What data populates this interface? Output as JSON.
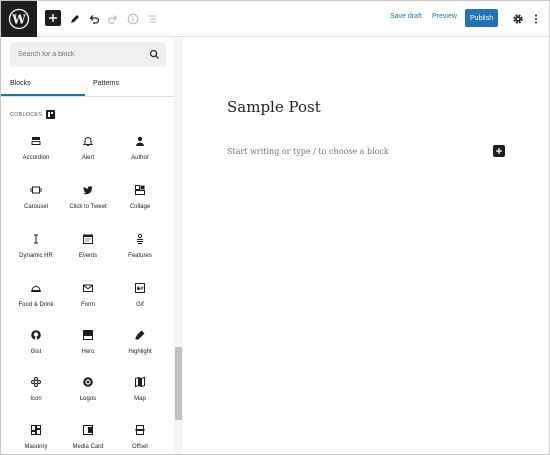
{
  "toolbar": {
    "save_draft": "Save draft",
    "preview": "Preview",
    "publish": "Publish",
    "accent": "#2271b1"
  },
  "sidebar": {
    "search_placeholder": "Search for a block",
    "tabs": [
      {
        "label": "Blocks",
        "active": true
      },
      {
        "label": "Patterns",
        "active": false
      }
    ],
    "category": "COBLOCKS",
    "blocks": [
      {
        "label": "Accordion",
        "icon": "accordion-icon"
      },
      {
        "label": "Alert",
        "icon": "bell-icon"
      },
      {
        "label": "Author",
        "icon": "person-icon"
      },
      {
        "label": "Carousel",
        "icon": "carousel-icon"
      },
      {
        "label": "Click to Tweet",
        "icon": "twitter-icon"
      },
      {
        "label": "Collage",
        "icon": "collage-icon"
      },
      {
        "label": "Dynamic HR",
        "icon": "dynamic-hr-icon"
      },
      {
        "label": "Events",
        "icon": "calendar-icon"
      },
      {
        "label": "Features",
        "icon": "features-icon"
      },
      {
        "label": "Food & Drink",
        "icon": "cloche-icon"
      },
      {
        "label": "Form",
        "icon": "envelope-icon"
      },
      {
        "label": "Gif",
        "icon": "gif-icon"
      },
      {
        "label": "Gist",
        "icon": "github-icon"
      },
      {
        "label": "Hero",
        "icon": "hero-icon"
      },
      {
        "label": "Highlight",
        "icon": "highlighter-icon"
      },
      {
        "label": "Icon",
        "icon": "icon-block-icon"
      },
      {
        "label": "Logos",
        "icon": "logos-icon"
      },
      {
        "label": "Map",
        "icon": "map-icon"
      },
      {
        "label": "Masonry",
        "icon": "masonry-icon"
      },
      {
        "label": "Media Card",
        "icon": "media-card-icon"
      },
      {
        "label": "Offset",
        "icon": "offset-icon"
      }
    ]
  },
  "editor": {
    "title": "Sample Post",
    "placeholder": "Start writing or type / to choose a block"
  }
}
